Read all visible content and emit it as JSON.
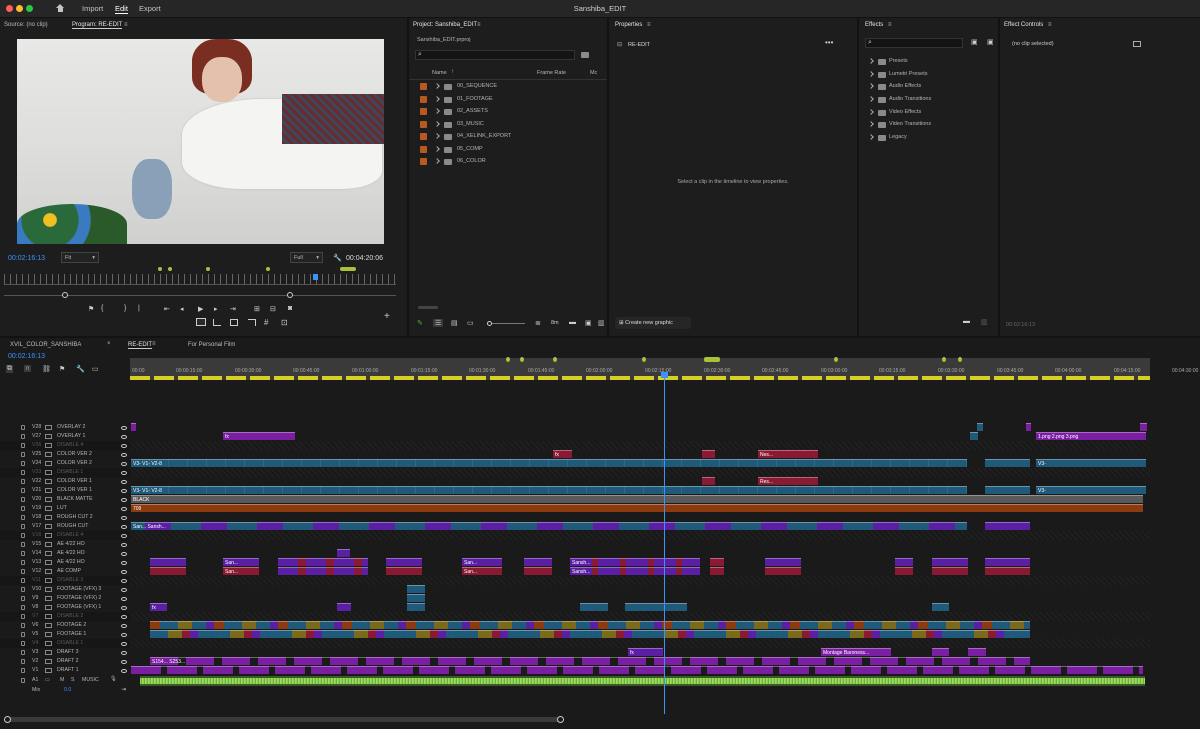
{
  "app": {
    "title": "Sanshiba_EDIT",
    "menu": [
      "Import",
      "Edit",
      "Export"
    ],
    "active_menu": "Edit"
  },
  "colors": {
    "accent": "#3b92ff",
    "overlay": "#7a1fa2",
    "color_ver": "#1f5a7a",
    "red": "#8a1a33",
    "lut": "#8c3a0f",
    "black_matte": "#5a5a5a",
    "audio": "#6fae3f"
  },
  "monitor": {
    "source_tab": "Source: (no clip)",
    "program_tab": "Program: RE-EDIT",
    "timecode": "00:02:16:13",
    "duration": "00:04:20:06",
    "fit": "Fit",
    "quality": "Full"
  },
  "project": {
    "tab": "Project: Sanshiba_EDIT",
    "file": "Sanshiba_EDIT.prproj",
    "columns": {
      "name": "Name",
      "frame_rate": "Frame Rate",
      "media": "Mc"
    },
    "bins": [
      "00_SEQUENCE",
      "01_FOOTAGE",
      "02_ASSETS",
      "03_MUSIC",
      "04_XELINK_EXPORT",
      "05_COMP",
      "06_COLOR"
    ],
    "footer": "8m"
  },
  "properties": {
    "tab": "Properties",
    "sequence": "RE-EDIT",
    "hint": "Select a clip in the timeline to view properties.",
    "create_graphic": "Create new graphic"
  },
  "effects": {
    "tab": "Effects",
    "items": [
      "Presets",
      "Lumetri Presets",
      "Audio Effects",
      "Audio Transitions",
      "Video Effects",
      "Video Transitions",
      "Legacy"
    ]
  },
  "effect_controls": {
    "tab": "Effect Controls",
    "status": "(no clip selected)",
    "timecode": "00:02:16:13"
  },
  "timeline": {
    "tabs": [
      "XVIL_COLOR_SANSHIBA",
      "RE-EDIT",
      "For Personal Film"
    ],
    "active_tab": "RE-EDIT",
    "timecode": "00:02:16:13",
    "ruler": [
      "00:00",
      "00:00:15:00",
      "00:00:30:00",
      "00:00:45:00",
      "00:01:00:00",
      "00:01:15:00",
      "00:01:30:00",
      "00:01:45:00",
      "00:02:00:00",
      "00:02:15:00",
      "00:02:30:00",
      "00:02:45:00",
      "00:03:00:00",
      "00:03:15:00",
      "00:03:30:00",
      "00:03:45:00",
      "00:04:00:00",
      "00:04:15:00",
      "00:04:30:00"
    ],
    "tracks": [
      {
        "id": "V28",
        "name": "OVERLAY 2"
      },
      {
        "id": "V27",
        "name": "OVERLAY 1"
      },
      {
        "id": "V26",
        "name": "DISABLE 4",
        "disabled": true
      },
      {
        "id": "V25",
        "name": "COLOR VER 2"
      },
      {
        "id": "V24",
        "name": "COLOR VER 2"
      },
      {
        "id": "V23",
        "name": "DISABLE 1",
        "disabled": true
      },
      {
        "id": "V22",
        "name": "COLOR VER 1"
      },
      {
        "id": "V21",
        "name": "COLOR VER 1"
      },
      {
        "id": "V20",
        "name": "BLACK MATTE"
      },
      {
        "id": "V19",
        "name": "LUT"
      },
      {
        "id": "V18",
        "name": "ROUGH CUT 2"
      },
      {
        "id": "V17",
        "name": "ROUGH CUT"
      },
      {
        "id": "V16",
        "name": "DISABLE 4",
        "disabled": true
      },
      {
        "id": "V15",
        "name": "AE 4/22 HO"
      },
      {
        "id": "V14",
        "name": "AE 4/22 HO"
      },
      {
        "id": "V13",
        "name": "AE 4/22 HO"
      },
      {
        "id": "V12",
        "name": "AE COMP"
      },
      {
        "id": "V11",
        "name": "DISABLE 3",
        "disabled": true
      },
      {
        "id": "V10",
        "name": "FOOTAGE (VFX) 3"
      },
      {
        "id": "V9",
        "name": "FOOTAGE (VFX) 2"
      },
      {
        "id": "V8",
        "name": "FOOTAGE (VFX) 1"
      },
      {
        "id": "V7",
        "name": "DISABLE 2",
        "disabled": true
      },
      {
        "id": "V6",
        "name": "FOOTAGE 2"
      },
      {
        "id": "V5",
        "name": "FOOTAGE 1"
      },
      {
        "id": "V4",
        "name": "DISABLE 1",
        "disabled": true
      },
      {
        "id": "V3",
        "name": "DRAFT 3"
      },
      {
        "id": "V2",
        "name": "DRAFT 2"
      },
      {
        "id": "V1",
        "name": "DRAFT 1"
      },
      {
        "id": "A1",
        "name": "MUSIC"
      }
    ],
    "audio_controls": {
      "m": "M",
      "s": "S"
    },
    "mix": {
      "label": "Mix",
      "value": "0.0"
    },
    "clip_labels": {
      "fx": "fx",
      "v3": "V3-",
      "v1": "V1-",
      "v2": "V2-8",
      "ness": "Nes...",
      "res": "Res...",
      "black": "BLACK",
      "lut": "709",
      "san": "San...",
      "sansh": "Sansh...",
      "s154": "S154...",
      "s253": "S253...",
      "montage": "Montage Baroness...",
      "png1": "1.png",
      "png2": "2.png",
      "png3": "3.png"
    }
  }
}
